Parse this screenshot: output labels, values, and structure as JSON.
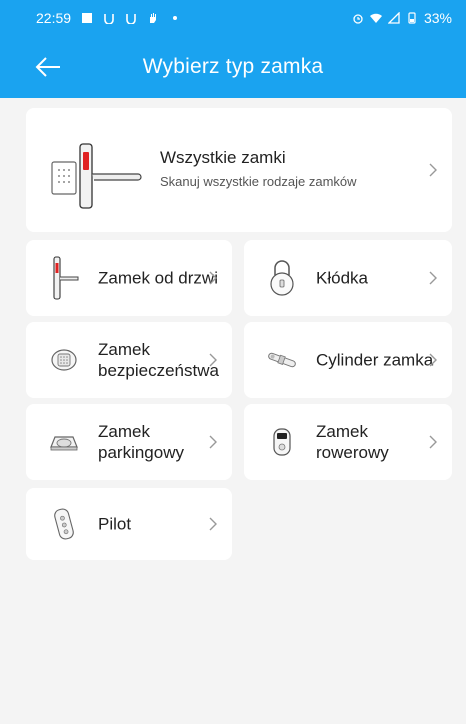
{
  "status_bar": {
    "time": "22:59",
    "battery": "33%"
  },
  "header": {
    "title": "Wybierz typ zamka"
  },
  "all_locks": {
    "title": "Wszystkie zamki",
    "subtitle": "Skanuj wszystkie rodzaje zamków"
  },
  "lock_types": [
    {
      "label": "Zamek od drzwi",
      "icon": "door-lock-icon"
    },
    {
      "label": "Kłódka",
      "icon": "padlock-icon"
    },
    {
      "label": "Zamek bezpieczeństwa",
      "icon": "safe-lock-icon"
    },
    {
      "label": "Cylinder zamka",
      "icon": "cylinder-lock-icon"
    },
    {
      "label": "Zamek parkingowy",
      "icon": "parking-lock-icon"
    },
    {
      "label": "Zamek rowerowy",
      "icon": "bike-lock-icon"
    },
    {
      "label": "Pilot",
      "icon": "remote-icon"
    }
  ],
  "colors": {
    "header": "#1aa3f0",
    "background": "#f4f4f4",
    "card": "#ffffff"
  }
}
